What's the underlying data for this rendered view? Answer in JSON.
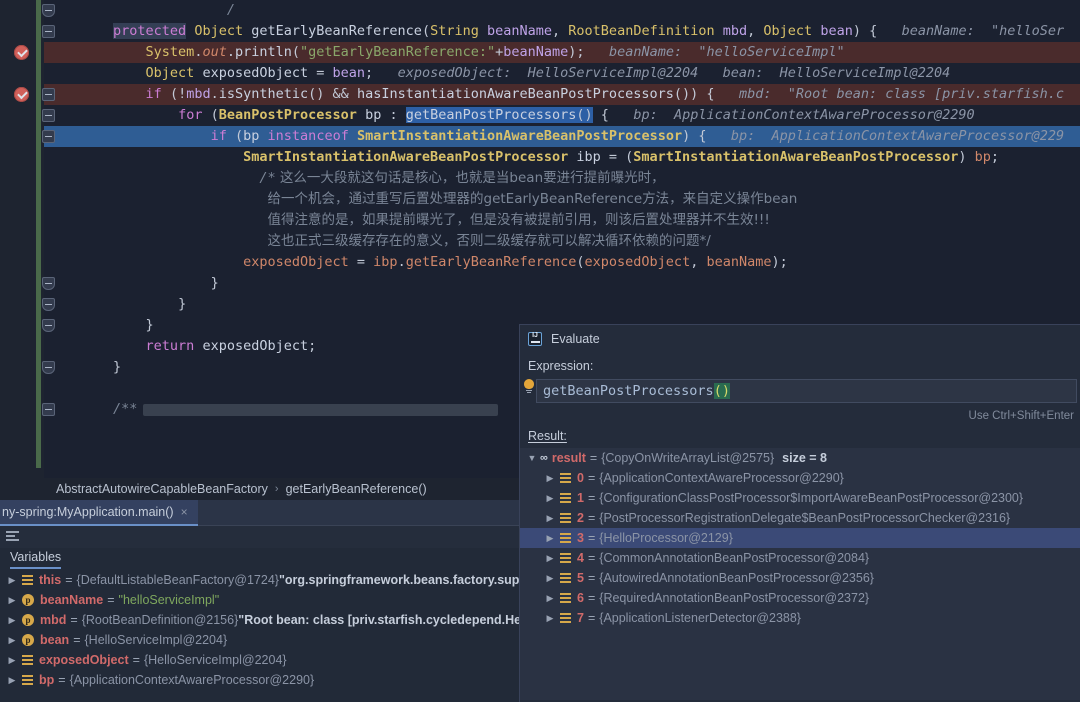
{
  "editor": {
    "lines": [
      {
        "indent": 22,
        "marker": "fold-end",
        "tokens": [
          {
            "t": "cmt",
            "s": "/"
          }
        ]
      },
      {
        "indent": 8,
        "marker": "fold",
        "highlight": null,
        "tokens": [
          {
            "t": "kw",
            "s": "protected",
            "hl": "ident"
          },
          {
            "t": "plain",
            "s": " "
          },
          {
            "t": "type",
            "s": "Object"
          },
          {
            "t": "plain",
            "s": " "
          },
          {
            "t": "meth",
            "s": "getEarlyBeanReference"
          },
          {
            "t": "punct",
            "s": "("
          },
          {
            "t": "type",
            "s": "String"
          },
          {
            "t": "plain",
            "s": " "
          },
          {
            "t": "param",
            "s": "beanName"
          },
          {
            "t": "punct",
            "s": ", "
          },
          {
            "t": "type",
            "s": "RootBeanDefinition"
          },
          {
            "t": "plain",
            "s": " "
          },
          {
            "t": "param",
            "s": "mbd"
          },
          {
            "t": "punct",
            "s": ", "
          },
          {
            "t": "type",
            "s": "Object"
          },
          {
            "t": "plain",
            "s": " "
          },
          {
            "t": "param",
            "s": "bean"
          },
          {
            "t": "punct",
            "s": ") {"
          },
          {
            "t": "hint",
            "s": "   beanName:  \"helloSer"
          }
        ]
      },
      {
        "indent": 12,
        "marker": "breakpoint",
        "highlight": "bp",
        "tokens": [
          {
            "t": "type",
            "s": "System"
          },
          {
            "t": "punct",
            "s": "."
          },
          {
            "t": "field-it",
            "s": "out"
          },
          {
            "t": "punct",
            "s": "."
          },
          {
            "t": "meth",
            "s": "println"
          },
          {
            "t": "punct",
            "s": "("
          },
          {
            "t": "str",
            "s": "\"getEarlyBeanReference:\""
          },
          {
            "t": "punct",
            "s": "+"
          },
          {
            "t": "param",
            "s": "beanName"
          },
          {
            "t": "punct",
            "s": ");"
          },
          {
            "t": "hint",
            "s": "   beanName:  \"helloServiceImpl\""
          }
        ]
      },
      {
        "indent": 12,
        "marker": null,
        "highlight": null,
        "tokens": [
          {
            "t": "type",
            "s": "Object"
          },
          {
            "t": "plain",
            "s": " "
          },
          {
            "t": "ident",
            "s": "exposedObject"
          },
          {
            "t": "punct",
            "s": " = "
          },
          {
            "t": "param",
            "s": "bean"
          },
          {
            "t": "punct",
            "s": ";"
          },
          {
            "t": "hint",
            "s": "   exposedObject:  HelloServiceImpl@2204   bean:  HelloServiceImpl@2204"
          }
        ]
      },
      {
        "indent": 12,
        "marker": "breakpoint-fold",
        "highlight": "bp",
        "tokens": [
          {
            "t": "kw",
            "s": "if"
          },
          {
            "t": "plain",
            "s": " "
          },
          {
            "t": "punct",
            "s": "(!"
          },
          {
            "t": "param",
            "s": "mbd"
          },
          {
            "t": "punct",
            "s": "."
          },
          {
            "t": "meth",
            "s": "isSynthetic"
          },
          {
            "t": "punct",
            "s": "() && "
          },
          {
            "t": "meth",
            "s": "hasInstantiationAwareBeanPostProcessors"
          },
          {
            "t": "punct",
            "s": "()) {"
          },
          {
            "t": "hint",
            "s": "   mbd:  \"Root bean: class [priv.starfish.c"
          }
        ]
      },
      {
        "indent": 16,
        "marker": "fold",
        "highlight": null,
        "tokens": [
          {
            "t": "kw",
            "s": "for"
          },
          {
            "t": "plain",
            "s": " "
          },
          {
            "t": "punct",
            "s": "("
          },
          {
            "t": "cls",
            "s": "BeanPostProcessor"
          },
          {
            "t": "plain",
            "s": " "
          },
          {
            "t": "ident",
            "s": "bp"
          },
          {
            "t": "punct",
            "s": " : "
          },
          {
            "t": "meth",
            "s": "getBeanPostProcessors",
            "hl": "sel"
          },
          {
            "t": "punct",
            "s": "()",
            "hl": "sel"
          },
          {
            "t": "punct",
            "s": " {"
          },
          {
            "t": "hint",
            "s": "   bp:  ApplicationContextAwareProcessor@2290"
          }
        ]
      },
      {
        "indent": 20,
        "marker": "fold",
        "highlight": "cur",
        "tokens": [
          {
            "t": "kw",
            "s": "if"
          },
          {
            "t": "plain",
            "s": " "
          },
          {
            "t": "punct",
            "s": "("
          },
          {
            "t": "ident",
            "s": "bp"
          },
          {
            "t": "plain",
            "s": " "
          },
          {
            "t": "kw",
            "s": "instanceof"
          },
          {
            "t": "plain",
            "s": " "
          },
          {
            "t": "cls",
            "s": "SmartInstantiationAwareBeanPostProcessor"
          },
          {
            "t": "punct",
            "s": ") {"
          },
          {
            "t": "hint",
            "s": "   bp:  ApplicationContextAwareProcessor@229"
          }
        ]
      },
      {
        "indent": 24,
        "marker": null,
        "highlight": null,
        "tokens": [
          {
            "t": "cls",
            "s": "SmartInstantiationAwareBeanPostProcessor"
          },
          {
            "t": "plain",
            "s": " "
          },
          {
            "t": "ident",
            "s": "ibp"
          },
          {
            "t": "punct",
            "s": " = ("
          },
          {
            "t": "cls",
            "s": "SmartInstantiationAwareBeanPostProcessor"
          },
          {
            "t": "punct",
            "s": ") "
          },
          {
            "t": "field",
            "s": "bp"
          },
          {
            "t": "punct",
            "s": ";"
          }
        ]
      },
      {
        "indent": 26,
        "marker": null,
        "highlight": null,
        "tokens": [
          {
            "t": "cmt",
            "s": "/*"
          },
          {
            "t": "cmtcn",
            "s": " 这么一大段就这句话是核心，也就是当bean要进行提前曝光时，"
          }
        ]
      },
      {
        "indent": 27,
        "marker": null,
        "highlight": null,
        "tokens": [
          {
            "t": "cmtcn",
            "s": "给一个机会，通过重写后置处理器的getEarlyBeanReference方法，来自定义操作bean"
          }
        ]
      },
      {
        "indent": 27,
        "marker": null,
        "highlight": null,
        "tokens": [
          {
            "t": "cmtcn",
            "s": "值得注意的是，如果提前曝光了，但是没有被提前引用，则该后置处理器并不生效!!!"
          }
        ]
      },
      {
        "indent": 27,
        "marker": null,
        "highlight": null,
        "tokens": [
          {
            "t": "cmtcn",
            "s": "这也正式三级缓存存在的意义，否则二级缓存就可以解决循环依赖的问题*/"
          }
        ]
      },
      {
        "indent": 24,
        "marker": null,
        "highlight": null,
        "tokens": [
          {
            "t": "field",
            "s": "exposedObject"
          },
          {
            "t": "punct",
            "s": " = "
          },
          {
            "t": "field",
            "s": "ibp"
          },
          {
            "t": "punct",
            "s": "."
          },
          {
            "t": "field",
            "s": "getEarlyBeanReference"
          },
          {
            "t": "punct",
            "s": "("
          },
          {
            "t": "field",
            "s": "exposedObject"
          },
          {
            "t": "punct",
            "s": ", "
          },
          {
            "t": "field",
            "s": "beanName"
          },
          {
            "t": "punct",
            "s": ");"
          }
        ]
      },
      {
        "indent": 20,
        "marker": "fold-end",
        "highlight": null,
        "tokens": [
          {
            "t": "punct",
            "s": "}"
          }
        ]
      },
      {
        "indent": 16,
        "marker": "fold-end",
        "highlight": null,
        "tokens": [
          {
            "t": "punct",
            "s": "}"
          }
        ]
      },
      {
        "indent": 12,
        "marker": "fold-end",
        "highlight": null,
        "tokens": [
          {
            "t": "punct",
            "s": "}"
          }
        ]
      },
      {
        "indent": 12,
        "marker": null,
        "highlight": null,
        "tokens": [
          {
            "t": "kw",
            "s": "return"
          },
          {
            "t": "plain",
            "s": " "
          },
          {
            "t": "ident",
            "s": "exposedObject"
          },
          {
            "t": "punct",
            "s": ";"
          }
        ]
      },
      {
        "indent": 8,
        "marker": "fold-end",
        "highlight": null,
        "tokens": [
          {
            "t": "punct",
            "s": "}"
          }
        ]
      },
      {
        "indent": 0,
        "marker": null,
        "highlight": null,
        "tokens": []
      },
      {
        "indent": 8,
        "marker": "fold",
        "highlight": null,
        "folded": true,
        "tokens": [
          {
            "t": "cmt",
            "s": "/**"
          }
        ]
      }
    ]
  },
  "breadcrumb": {
    "class": "AbstractAutowireCapableBeanFactory",
    "separator": "›",
    "method": "getEarlyBeanReference()"
  },
  "debug_window": {
    "run_tab": {
      "label": "ny-spring:MyApplication.main()",
      "close": "×"
    },
    "toolbar": {
      "layout_icon": "layout-settings-icon"
    },
    "variables_tab": "Variables",
    "variables": [
      {
        "arrow": "▶",
        "icon": "list",
        "name": "this",
        "eq": "=",
        "ref": "{DefaultListableBeanFactory@1724}",
        "desc": "\"org.springframework.beans.factory.support"
      },
      {
        "arrow": "▶",
        "icon": "param",
        "name": "beanName",
        "eq": "=",
        "ref": "",
        "str": "\"helloServiceImpl\""
      },
      {
        "arrow": "▶",
        "icon": "param",
        "name": "mbd",
        "eq": "=",
        "ref": "{RootBeanDefinition@2156}",
        "desc": "\"Root bean: class [priv.starfish.cycledepend.HelloSe"
      },
      {
        "arrow": "▶",
        "icon": "param",
        "name": "bean",
        "eq": "=",
        "ref": "{HelloServiceImpl@2204}"
      },
      {
        "arrow": "▶",
        "icon": "list",
        "name": "exposedObject",
        "eq": "=",
        "ref": "{HelloServiceImpl@2204}"
      },
      {
        "arrow": "▶",
        "icon": "list",
        "name": "bp",
        "eq": "=",
        "ref": "{ApplicationContextAwareProcessor@2290}"
      }
    ]
  },
  "evaluate": {
    "title": "Evaluate",
    "title_icon": "intellij-idea-icon",
    "expression_label": "Expression:",
    "expression_prefix": "getBeanPostProcessors",
    "expression_brackets": "()",
    "bulb_icon": "lightbulb-icon",
    "hint": "Use Ctrl+Shift+Enter",
    "result_label": "Result:",
    "result_root": {
      "arrow": "▼",
      "icon": "oo",
      "name": "result",
      "eq": "=",
      "ref": "{CopyOnWriteArrayList@2575}",
      "size": "size = 8"
    },
    "result_items": [
      {
        "arrow": "▶",
        "icon": "list",
        "index": "0",
        "eq": "=",
        "ref": "{ApplicationContextAwareProcessor@2290}",
        "selected": false
      },
      {
        "arrow": "▶",
        "icon": "list",
        "index": "1",
        "eq": "=",
        "ref": "{ConfigurationClassPostProcessor$ImportAwareBeanPostProcessor@2300}",
        "selected": false
      },
      {
        "arrow": "▶",
        "icon": "list",
        "index": "2",
        "eq": "=",
        "ref": "{PostProcessorRegistrationDelegate$BeanPostProcessorChecker@2316}",
        "selected": false
      },
      {
        "arrow": "▶",
        "icon": "list",
        "index": "3",
        "eq": "=",
        "ref": "{HelloProcessor@2129}",
        "selected": true
      },
      {
        "arrow": "▶",
        "icon": "list",
        "index": "4",
        "eq": "=",
        "ref": "{CommonAnnotationBeanPostProcessor@2084}",
        "selected": false
      },
      {
        "arrow": "▶",
        "icon": "list",
        "index": "5",
        "eq": "=",
        "ref": "{AutowiredAnnotationBeanPostProcessor@2356}",
        "selected": false
      },
      {
        "arrow": "▶",
        "icon": "list",
        "index": "6",
        "eq": "=",
        "ref": "{RequiredAnnotationBeanPostProcessor@2372}",
        "selected": false
      },
      {
        "arrow": "▶",
        "icon": "list",
        "index": "7",
        "eq": "=",
        "ref": "{ApplicationListenerDetector@2388}",
        "selected": false
      }
    ]
  },
  "colors": {
    "editor_bg": "#1b2130",
    "panel_bg": "#242c3b",
    "breakpoint_line": "#4a2b2c",
    "current_line": "#2f5d94",
    "selection": "#214283",
    "accent": "#6a90c8",
    "breakpoint_red": "#d1605a",
    "keyword": "#cc7dd4",
    "type": "#d9c16a",
    "string": "#8aa86b",
    "hint": "#8b94a6",
    "var_name": "#d16a6a",
    "icon_yellow": "#d6a84a"
  }
}
